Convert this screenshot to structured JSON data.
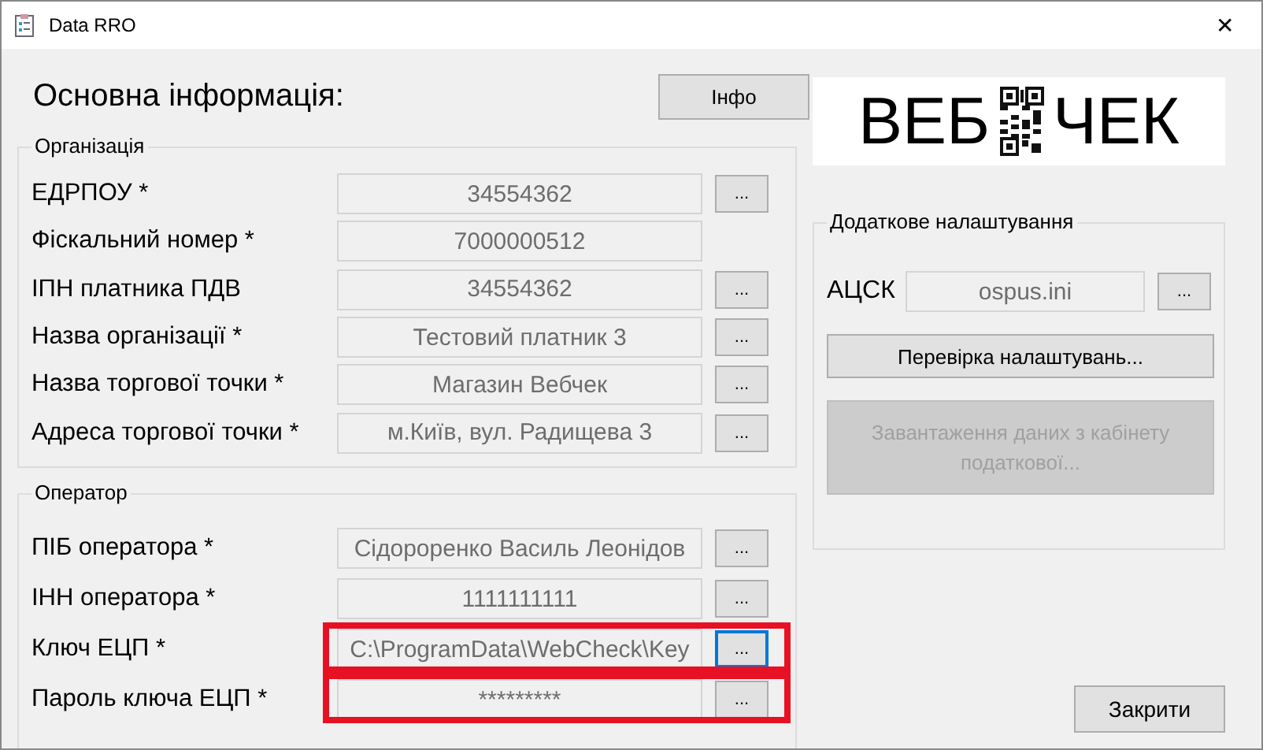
{
  "window": {
    "title": "Data RRO",
    "close": "✕"
  },
  "heading": "Основна інформація:",
  "info_button": "Інфо",
  "organization": {
    "title": "Організація",
    "rows": [
      {
        "label": "ЕДРПОУ *",
        "value": "34554362",
        "button": "...",
        "has_button": true,
        "focused": false,
        "highlighted": false
      },
      {
        "label": "Фіскальний номер *",
        "value": "7000000512",
        "has_button": false,
        "focused": false,
        "highlighted": false
      },
      {
        "label": "ІПН платника ПДВ",
        "value": "34554362",
        "button": "...",
        "has_button": true,
        "focused": false,
        "highlighted": false
      },
      {
        "label": "Назва організації *",
        "value": "Тестовий платник 3",
        "button": "...",
        "has_button": true,
        "focused": false,
        "highlighted": false
      },
      {
        "label": "Назва торгової точки *",
        "value": "Магазин Вебчек",
        "button": "...",
        "has_button": true,
        "focused": false,
        "highlighted": false
      },
      {
        "label": "Адреса торгової точки *",
        "value": "м.Київ, вул. Радищева 3",
        "button": "...",
        "has_button": true,
        "focused": false,
        "highlighted": false
      }
    ]
  },
  "operator": {
    "title": "Оператор",
    "rows": [
      {
        "label": "ПІБ оператора *",
        "value": "Сідороренко Василь Леонідов",
        "button": "...",
        "has_button": true,
        "focused": false,
        "highlighted": false
      },
      {
        "label": "ІНН оператора *",
        "value": "1111111111",
        "button": "...",
        "has_button": true,
        "focused": false,
        "highlighted": false
      },
      {
        "label": "Ключ ЕЦП *",
        "value": "C:\\ProgramData\\WebCheck\\Key",
        "button": "...",
        "has_button": true,
        "focused": true,
        "highlighted": true
      },
      {
        "label": "Пароль ключа ЕЦП *",
        "value": "*********",
        "button": "...",
        "has_button": true,
        "focused": false,
        "highlighted": true
      }
    ]
  },
  "logo": {
    "left": "ВЕБ",
    "right": "ЧЕК"
  },
  "extra": {
    "title": "Додаткове налаштування",
    "acsk_label": "АЦСК",
    "acsk_value": "ospus.ini",
    "acsk_button": "...",
    "buttons": [
      {
        "label": "Перевірка налаштувань...",
        "disabled": false
      },
      {
        "label": "Завантаження даних з кабінету податкової...",
        "disabled": true
      }
    ]
  },
  "close_button": "Закрити"
}
